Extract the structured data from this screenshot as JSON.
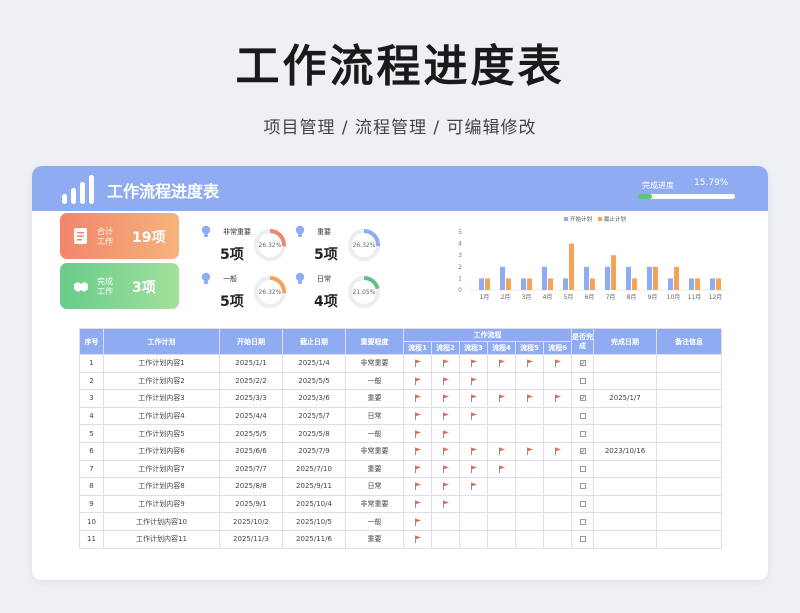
{
  "page": {
    "title": "工作流程进度表",
    "subtitle": "项目管理 / 流程管理 / 可编辑修改"
  },
  "header": {
    "title": "工作流程进度表",
    "progress_label": "完成进度",
    "progress_value": "15.79%",
    "progress_fraction": 0.1579
  },
  "summary": {
    "total": {
      "label": "合计工作",
      "value": "19项"
    },
    "done": {
      "label": "完成工作",
      "value": "3项"
    }
  },
  "stats": [
    {
      "label": "非常重要",
      "value": "5项",
      "pct": "26.32%",
      "fraction": 0.2632,
      "color": "#f2866d"
    },
    {
      "label": "重要",
      "value": "5项",
      "pct": "26.32%",
      "fraction": 0.2632,
      "color": "#8facf3"
    },
    {
      "label": "一般",
      "value": "5项",
      "pct": "26.32%",
      "fraction": 0.2632,
      "color": "#f6a35a"
    },
    {
      "label": "日常",
      "value": "4项",
      "pct": "21.05%",
      "fraction": 0.2105,
      "color": "#5bc48a"
    }
  ],
  "colors": {
    "accent": "#8facf3",
    "start_series": "#8facf3",
    "end_series": "#f6a35a",
    "flag": "#e36a4f"
  },
  "chart_data": {
    "type": "bar",
    "categories": [
      "1月",
      "2月",
      "3月",
      "4月",
      "5月",
      "6月",
      "7月",
      "8月",
      "9月",
      "10月",
      "11月",
      "12月"
    ],
    "series": [
      {
        "name": "开始计划",
        "values": [
          1,
          2,
          1,
          2,
          1,
          2,
          2,
          2,
          2,
          1,
          1,
          1
        ]
      },
      {
        "name": "截止计划",
        "values": [
          1,
          1,
          1,
          1,
          4,
          1,
          3,
          1,
          2,
          2,
          1,
          1
        ]
      }
    ],
    "ylim": [
      0,
      5
    ],
    "yticks": [
      0,
      1,
      2,
      3,
      4,
      5
    ],
    "legend": "top",
    "grid": false
  },
  "table": {
    "headers": {
      "index": "序号",
      "plan": "工作计划",
      "start": "开始日期",
      "end": "截止日期",
      "importance": "重要程度",
      "flow": "工作流程",
      "done": "是否完成",
      "done_date": "完成日期",
      "note": "备注信息"
    },
    "flow_steps": [
      "流程1",
      "流程2",
      "流程3",
      "流程4",
      "流程5",
      "流程6"
    ],
    "rows": [
      {
        "index": "1",
        "plan": "工作计划内容1",
        "start": "2025/1/1",
        "end": "2025/1/4",
        "importance": "非常重要",
        "flags": 6,
        "done": true,
        "done_date": "",
        "note": ""
      },
      {
        "index": "2",
        "plan": "工作计划内容2",
        "start": "2025/2/2",
        "end": "2025/5/5",
        "importance": "一般",
        "flags": 3,
        "done": false,
        "done_date": "",
        "note": ""
      },
      {
        "index": "3",
        "plan": "工作计划内容3",
        "start": "2025/3/3",
        "end": "2025/3/6",
        "importance": "重要",
        "flags": 6,
        "done": true,
        "done_date": "2025/1/7",
        "note": ""
      },
      {
        "index": "4",
        "plan": "工作计划内容4",
        "start": "2025/4/4",
        "end": "2025/5/7",
        "importance": "日常",
        "flags": 3,
        "done": false,
        "done_date": "",
        "note": ""
      },
      {
        "index": "5",
        "plan": "工作计划内容5",
        "start": "2025/5/5",
        "end": "2025/5/8",
        "importance": "一般",
        "flags": 2,
        "done": false,
        "done_date": "",
        "note": ""
      },
      {
        "index": "6",
        "plan": "工作计划内容6",
        "start": "2025/6/6",
        "end": "2025/7/9",
        "importance": "非常重要",
        "flags": 6,
        "done": true,
        "done_date": "2023/10/16",
        "note": ""
      },
      {
        "index": "7",
        "plan": "工作计划内容7",
        "start": "2025/7/7",
        "end": "2025/7/10",
        "importance": "重要",
        "flags": 4,
        "done": false,
        "done_date": "",
        "note": ""
      },
      {
        "index": "8",
        "plan": "工作计划内容8",
        "start": "2025/8/8",
        "end": "2025/9/11",
        "importance": "日常",
        "flags": 3,
        "done": false,
        "done_date": "",
        "note": ""
      },
      {
        "index": "9",
        "plan": "工作计划内容9",
        "start": "2025/9/1",
        "end": "2025/10/4",
        "importance": "非常重要",
        "flags": 2,
        "done": false,
        "done_date": "",
        "note": ""
      },
      {
        "index": "10",
        "plan": "工作计划内容10",
        "start": "2025/10/2",
        "end": "2025/10/5",
        "importance": "一般",
        "flags": 1,
        "done": false,
        "done_date": "",
        "note": ""
      },
      {
        "index": "11",
        "plan": "工作计划内容11",
        "start": "2025/11/3",
        "end": "2025/11/6",
        "importance": "重要",
        "flags": 1,
        "done": false,
        "done_date": "",
        "note": ""
      }
    ]
  }
}
